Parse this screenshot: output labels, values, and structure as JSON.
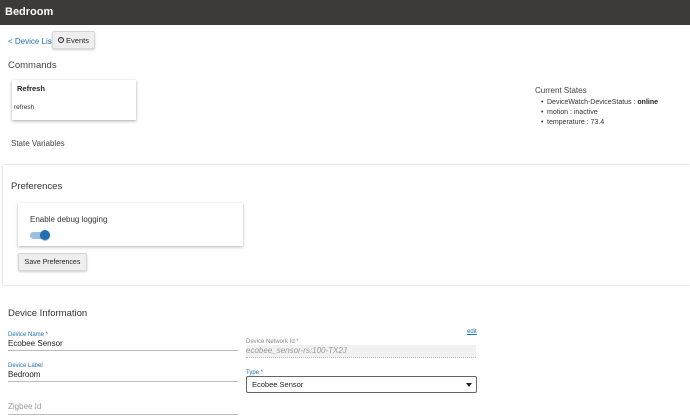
{
  "header": {
    "title": "Bedroom"
  },
  "nav": {
    "back_label": "< Device List",
    "events_label": "Events"
  },
  "commands": {
    "heading": "Commands",
    "items": [
      {
        "label": "Refresh",
        "param": "refresh"
      }
    ]
  },
  "current_states": {
    "title": "Current States",
    "items": [
      {
        "key": "DeviceWatch-DeviceStatus : ",
        "value": "online"
      },
      {
        "key": "motion : ",
        "value": "inactive"
      },
      {
        "key": "temperature : ",
        "value": "73.4"
      }
    ]
  },
  "state_variables": {
    "heading": "State Variables"
  },
  "preferences": {
    "heading": "Preferences",
    "debug_logging_label": "Enable debug logging",
    "debug_logging_enabled": true,
    "save_label": "Save Preferences"
  },
  "device_info": {
    "heading": "Device Information",
    "edit_link": "edit",
    "device_name": {
      "label": "Device Name *",
      "value": "Ecobee Sensor"
    },
    "device_network_id": {
      "label": "Device Network Id *",
      "value": "ecobee_sensor-rs:100-TX2J"
    },
    "device_label": {
      "label": "Device Label",
      "value": "Bedroom"
    },
    "type": {
      "label": "Type *",
      "value": "Ecobee Sensor"
    },
    "zigbee_id": {
      "placeholder": "Zigbee Id"
    }
  },
  "colors": {
    "header_bg": "#3e3a37",
    "accent": "#1f6fb5"
  }
}
